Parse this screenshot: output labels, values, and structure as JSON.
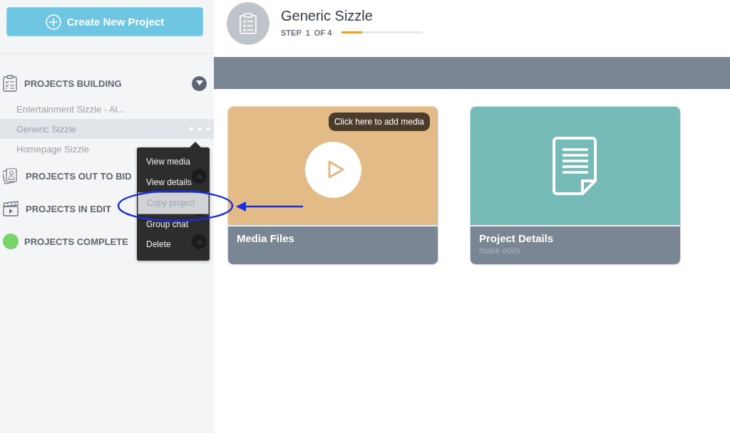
{
  "sidebar": {
    "create_button": "Create New Project",
    "sections": [
      {
        "kind": "clipboard",
        "title": "PROJECTS BUILDING",
        "expanded": true,
        "items": [
          {
            "label": "Entertainment Sizzle - Al...",
            "selected": false
          },
          {
            "label": "Generic Sizzle",
            "selected": true
          },
          {
            "label": "Homepage Sizzle",
            "selected": false
          }
        ]
      },
      {
        "kind": "cards",
        "title": "PROJECTS OUT TO BID",
        "expanded": false
      },
      {
        "kind": "clapper",
        "title": "PROJECTS IN EDIT",
        "expanded": false
      },
      {
        "kind": "dot",
        "title": "PROJECTS COMPLETE",
        "expanded": false,
        "color": "#77d36a"
      }
    ]
  },
  "context_menu": [
    {
      "label": "View media",
      "selected": false
    },
    {
      "label": "View details",
      "selected": false
    },
    {
      "label": "Copy project",
      "selected": true
    },
    {
      "label": "Group chat",
      "selected": false
    },
    {
      "label": "Delete",
      "selected": false
    }
  ],
  "header": {
    "title": "Generic Sizzle",
    "step": "STEP  1  OF 4",
    "level": 0.25
  },
  "cards": [
    {
      "kind": "media",
      "title": "Media Files",
      "tooltip": "Click here to add media"
    },
    {
      "kind": "details",
      "title": "Project Details",
      "subtitle": "make edits"
    }
  ]
}
